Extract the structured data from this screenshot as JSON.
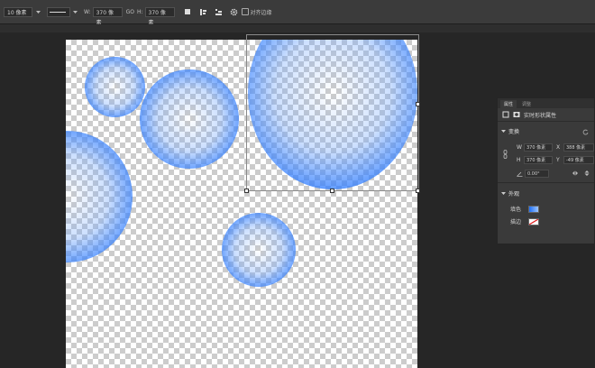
{
  "optionsBar": {
    "sizeValue": "10 像素",
    "wLabel": "W:",
    "wValue": "370 像素",
    "linkLabel": "GO",
    "hLabel": "H:",
    "hValue": "370 像素",
    "alignEdgesLabel": "对齐边缘"
  },
  "shapes": {
    "accentColor": "#1e6ff5"
  },
  "propertiesPanel": {
    "tabs": [
      "属性",
      "调整"
    ],
    "shapeTypeLabel": "实时形状属性",
    "transformSection": "变换",
    "wLabel": "W",
    "wValue": "370 像素",
    "xLabel": "X",
    "xValue": "388 像素",
    "hLabel": "H",
    "hValue": "370 像素",
    "yLabel": "Y",
    "yValue": "-49 像素",
    "angleValue": "0.00°",
    "appearanceSection": "外观",
    "fillLabel": "填色",
    "strokeLabel": "描边"
  }
}
